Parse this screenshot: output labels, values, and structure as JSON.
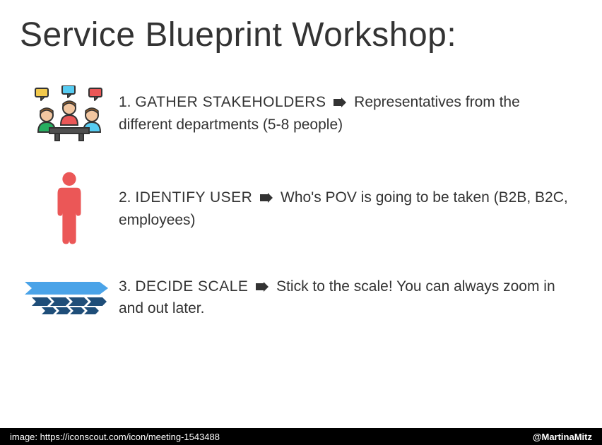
{
  "title": "Service Blueprint Workshop:",
  "items": [
    {
      "num": "1.",
      "heading": "GATHER STAKEHOLDERS",
      "desc": "Representatives from the different departments (5-8 people)"
    },
    {
      "num": "2.",
      "heading": "IDENTIFY USER",
      "desc": "Who's POV is going to be taken (B2B, B2C, employees)"
    },
    {
      "num": "3.",
      "heading": "DECIDE SCALE",
      "desc": "Stick to the scale! You can always zoom in and out later."
    }
  ],
  "footer": {
    "left": "image: https://iconscout.com/icon/meeting-1543488",
    "right": "@MartinaMitz"
  }
}
